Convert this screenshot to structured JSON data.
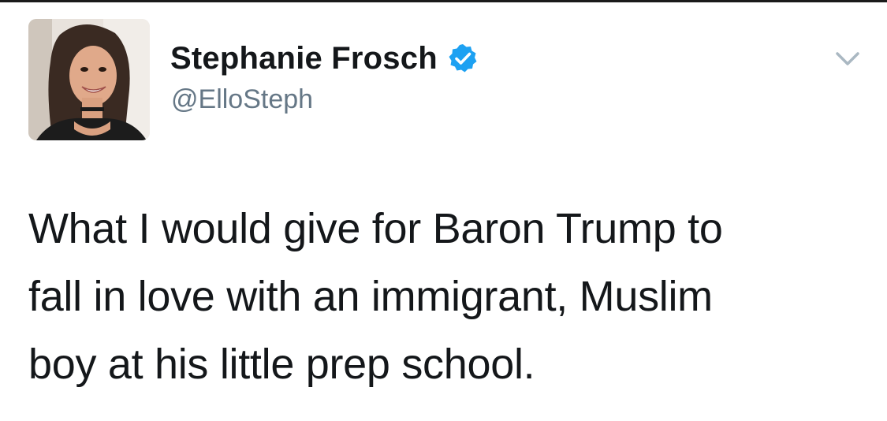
{
  "tweet": {
    "author": {
      "display_name": "Stephanie Frosch",
      "handle": "@ElloSteph",
      "verified": true,
      "avatar_icon": "profile-photo",
      "verified_icon": "verified-badge-icon",
      "verified_color": "#1da1f2"
    },
    "menu_icon": "chevron-down-icon",
    "text_lines": [
      "What I would give for Baron Trump to",
      "fall in love with an immigrant, Muslim",
      "boy at his little prep school."
    ]
  },
  "colors": {
    "text": "#14171a",
    "secondary_text": "#657786",
    "accent": "#1da1f2",
    "background": "#ffffff"
  }
}
